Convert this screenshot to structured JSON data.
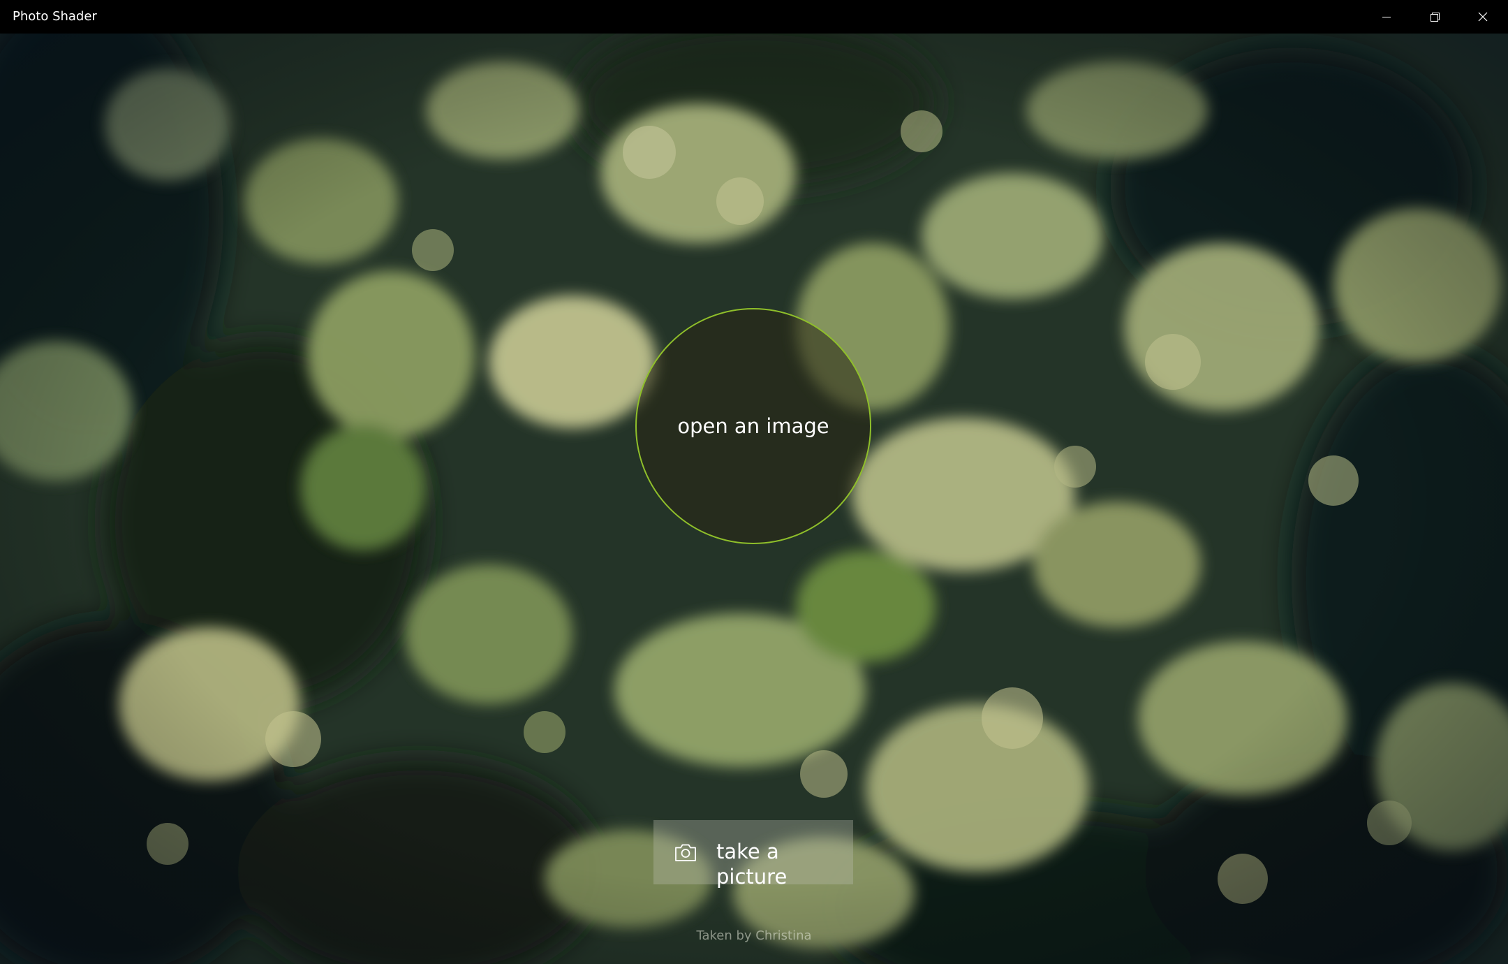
{
  "window": {
    "title": "Photo Shader",
    "minimize_icon": "minimize-icon",
    "restore_icon": "restore-icon",
    "close_icon": "close-icon"
  },
  "main": {
    "open_image_label": "open an image",
    "take_picture_label": "take a picture",
    "camera_icon": "camera-icon",
    "photo_credit": "Taken by Christina"
  },
  "colors": {
    "titlebar_bg": "#000000",
    "circle_border": "#8fbf2a",
    "text": "#ffffff"
  }
}
